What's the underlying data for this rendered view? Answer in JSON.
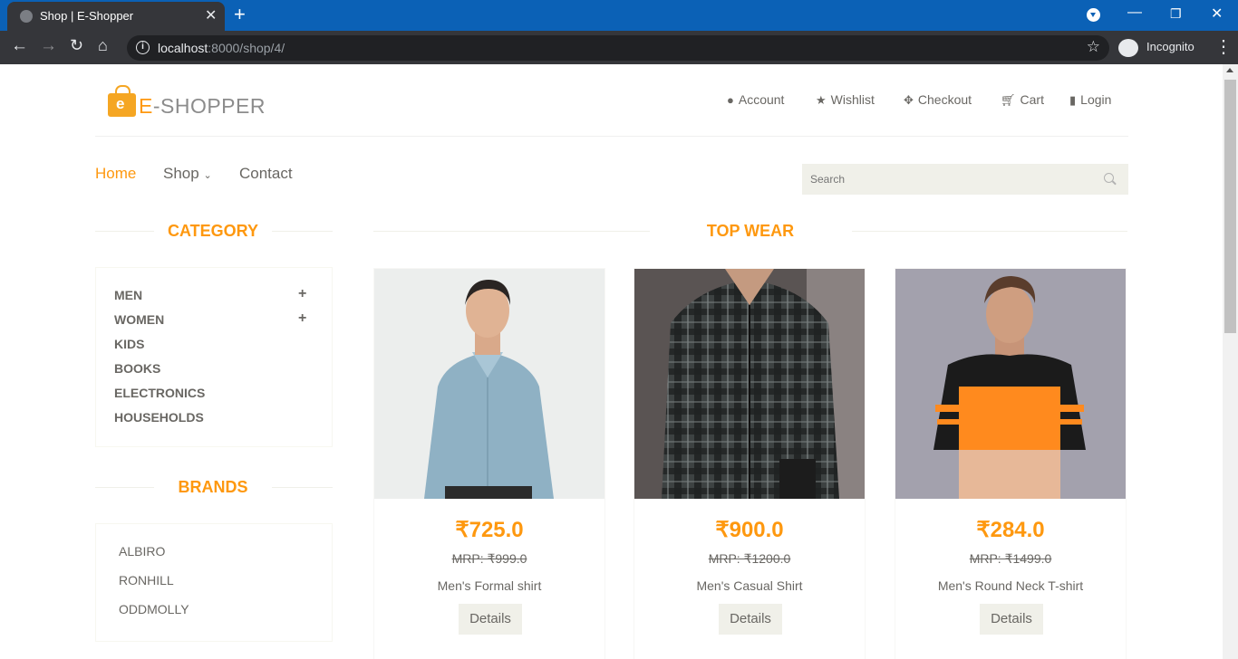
{
  "browser": {
    "tab_title": "Shop | E-Shopper",
    "url_host": "localhost",
    "url_path": ":8000/shop/4/",
    "profile_label": "Incognito"
  },
  "header": {
    "logo_letter": "e",
    "logo_e": "E",
    "logo_rest": "-SHOPPER",
    "nav": [
      {
        "label": "Account",
        "icon": "user-icon"
      },
      {
        "label": "Wishlist",
        "icon": "star-icon"
      },
      {
        "label": "Checkout",
        "icon": "crosshairs-icon"
      },
      {
        "label": "Cart",
        "icon": "cart-icon"
      },
      {
        "label": "Login",
        "icon": "lock-icon"
      }
    ]
  },
  "mainnav": {
    "home": "Home",
    "shop": "Shop",
    "contact": "Contact",
    "search_placeholder": "Search"
  },
  "sidebar": {
    "category_title": "CATEGORY",
    "categories": [
      "MEN",
      "WOMEN",
      "KIDS",
      "BOOKS",
      "ELECTRONICS",
      "HOUSEHOLDS"
    ],
    "brands_title": "BRANDS",
    "brands": [
      "ALBIRO",
      "RONHILL",
      "ODDMOLLY"
    ]
  },
  "main": {
    "section_title": "TOP WEAR",
    "details_label": "Details",
    "products": [
      {
        "price": "₹725.0",
        "mrp": "MRP: ₹999.0",
        "name": "Men's Formal shirt"
      },
      {
        "price": "₹900.0",
        "mrp": "MRP: ₹1200.0",
        "name": "Men's Casual Shirt"
      },
      {
        "price": "₹284.0",
        "mrp": "MRP: ₹1499.0",
        "name": "Men's Round Neck T-shirt"
      }
    ]
  },
  "colors": {
    "accent": "#fe980f",
    "text": "#696763",
    "chrome_blue": "#0b61b6"
  }
}
